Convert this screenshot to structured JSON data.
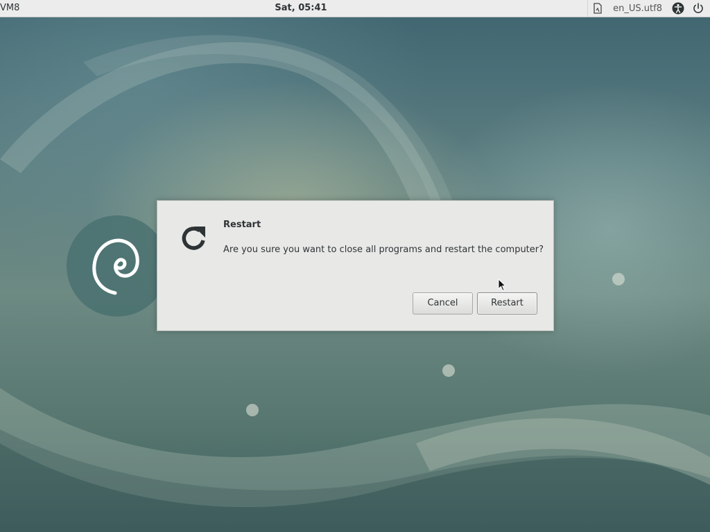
{
  "topbar": {
    "activities_label": "VM8",
    "clock": "Sat, 05:41",
    "locale": "en_US.utf8",
    "icons": {
      "keyboard": "keyboard-layout-icon",
      "accessibility": "accessibility-icon",
      "power": "power-icon"
    }
  },
  "desktop": {
    "logo": "debian-swirl-logo",
    "colors": {
      "panel_bg": "#ececec",
      "dialog_bg": "#e8e8e7",
      "text": "#2e3436"
    }
  },
  "dialog": {
    "icon": "restart-icon",
    "title": "Restart",
    "message": "Are you sure you want to close all programs and restart the computer?",
    "buttons": {
      "cancel": "Cancel",
      "restart": "Restart"
    }
  }
}
